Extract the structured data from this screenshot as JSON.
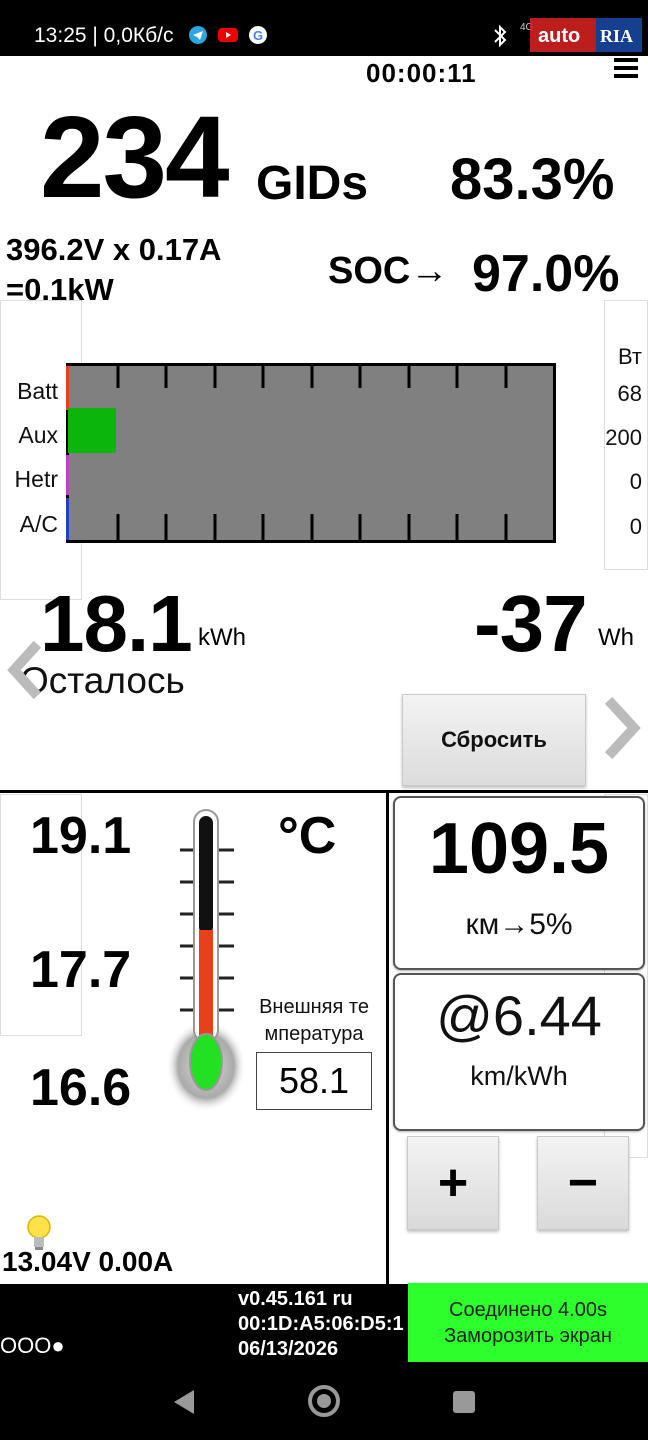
{
  "status_bar": {
    "time_speed": "13:25 | 0,0Кб/с",
    "network": "4G",
    "watermark": "autoRIA",
    "icons": [
      "telegram-icon",
      "youtube-icon",
      "google-icon",
      "bluetooth-icon"
    ]
  },
  "header": {
    "timer": "00:00:11"
  },
  "gids": {
    "value": "234",
    "unit": "GIDs",
    "percent": "83.3%"
  },
  "electrical": {
    "line1": "396.2V x 0.17A",
    "line2": "=0.1kW"
  },
  "soc": {
    "label": "SOC→",
    "value": "97.0%"
  },
  "power_chart": {
    "unit": "Вт",
    "rows": [
      {
        "label": "Batt",
        "value": "68"
      },
      {
        "label": "Aux",
        "value": "200"
      },
      {
        "label": "Hetr",
        "value": "0"
      },
      {
        "label": "A/C",
        "value": "0"
      }
    ]
  },
  "energy": {
    "remaining_value": "18.1",
    "remaining_unit": "kWh",
    "remaining_label": "Осталось",
    "trip_value": "-37",
    "trip_unit": "Wh",
    "reset_label": "Сбросить"
  },
  "temperature": {
    "high": "19.1",
    "mid": "17.7",
    "low": "16.6",
    "unit": "°C",
    "external_label": "Внешняя те мпература",
    "external_value": "58.1"
  },
  "aux_battery": "13.04V 0.00A",
  "range": {
    "value": "109.5",
    "label": "км→5%"
  },
  "efficiency": {
    "value": "@6.44",
    "label": "km/kWh"
  },
  "buttons": {
    "plus": "+",
    "minus": "−"
  },
  "footer": {
    "version": "v0.45.161 ru",
    "mac": "00:1D:A5:06:D5:1",
    "date": "06/13/2026",
    "dots": "OOO●",
    "connection": "Соединено 4.00s",
    "freeze": "Заморозить экран"
  },
  "colors": {
    "accent_green": "#2cff2c",
    "bar_gray": "#808080",
    "aux_green": "#0cb50c",
    "thermo_red": "#e8401c"
  }
}
